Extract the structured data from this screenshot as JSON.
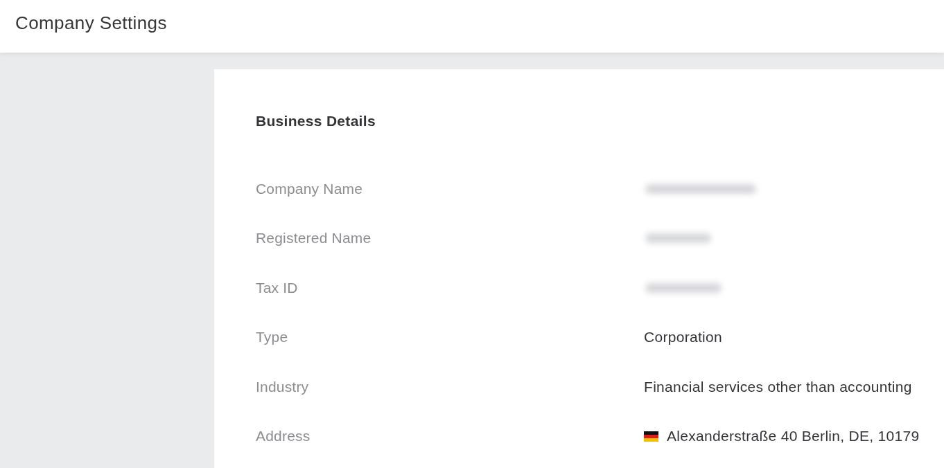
{
  "header": {
    "title": "Company Settings"
  },
  "card": {
    "title": "Business Details",
    "fields": [
      {
        "label": "Company Name",
        "kind": "redacted"
      },
      {
        "label": "Registered Name",
        "kind": "redacted"
      },
      {
        "label": "Tax ID",
        "kind": "redacted"
      },
      {
        "label": "Type",
        "kind": "text",
        "value": "Corporation"
      },
      {
        "label": "Industry",
        "kind": "text",
        "value": "Financial services other than accounting"
      },
      {
        "label": "Address",
        "kind": "address",
        "value": "Alexanderstraße 40 Berlin, DE, 10179"
      }
    ]
  }
}
